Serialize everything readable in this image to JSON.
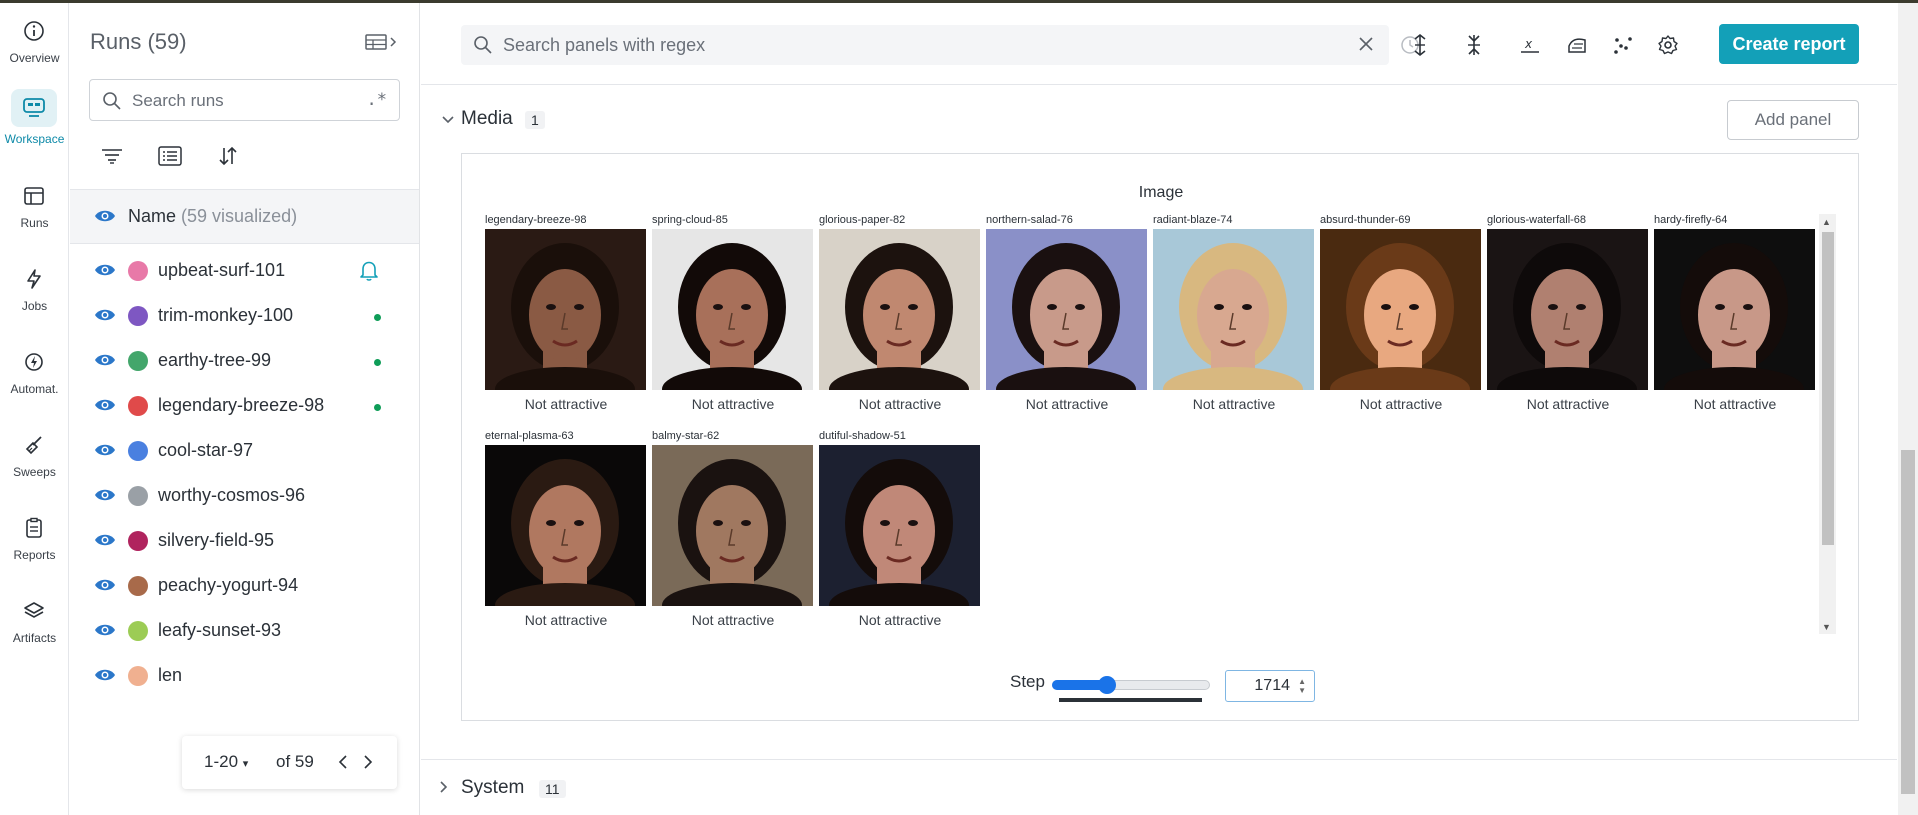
{
  "nav": {
    "items": [
      {
        "label": "Overview",
        "icon": "info-icon"
      },
      {
        "label": "Workspace",
        "icon": "workspace-icon",
        "active": true
      },
      {
        "label": "Runs",
        "icon": "table-icon"
      },
      {
        "label": "Jobs",
        "icon": "lightning-icon"
      },
      {
        "label": "Automat.",
        "icon": "automation-icon"
      },
      {
        "label": "Sweeps",
        "icon": "broom-icon"
      },
      {
        "label": "Reports",
        "icon": "clipboard-icon"
      },
      {
        "label": "Artifacts",
        "icon": "layers-icon"
      }
    ]
  },
  "runs": {
    "title": "Runs (59)",
    "search_placeholder": "Search runs",
    "regex_label": ".*",
    "header_name": "Name",
    "header_sub": "(59 visualized)",
    "rows": [
      {
        "name": "upbeat-surf-101",
        "color": "#e879a8",
        "status": "bell"
      },
      {
        "name": "trim-monkey-100",
        "color": "#7e57c2",
        "status": "live"
      },
      {
        "name": "earthy-tree-99",
        "color": "#43a66b",
        "status": "live"
      },
      {
        "name": "legendary-breeze-98",
        "color": "#e04a4a",
        "status": "live"
      },
      {
        "name": "cool-star-97",
        "color": "#4a80e0",
        "status": ""
      },
      {
        "name": "worthy-cosmos-96",
        "color": "#9aa0a6",
        "status": ""
      },
      {
        "name": "silvery-field-95",
        "color": "#b0245e",
        "status": ""
      },
      {
        "name": "peachy-yogurt-94",
        "color": "#a86a4a",
        "status": ""
      },
      {
        "name": "leafy-sunset-93",
        "color": "#9ccc55",
        "status": ""
      },
      {
        "name": "len",
        "color": "#f0b090",
        "status": ""
      }
    ],
    "pager": {
      "range": "1-20",
      "of": "of 59"
    }
  },
  "toolbar": {
    "search_placeholder": "Search panels with regex",
    "create_report": "Create report"
  },
  "media": {
    "title": "Media",
    "count": "1",
    "add_panel": "Add panel",
    "panel_title": "Image",
    "tiles": [
      {
        "run": "legendary-breeze-98",
        "caption": "Not attractive",
        "bg": "#2a1a14",
        "skin": "#8a5a44",
        "hair": "#1a0f0a"
      },
      {
        "run": "spring-cloud-85",
        "caption": "Not attractive",
        "bg": "#e6e6e6",
        "skin": "#a8705a",
        "hair": "#120a08"
      },
      {
        "run": "glorious-paper-82",
        "caption": "Not attractive",
        "bg": "#d8d2c8",
        "skin": "#c08870",
        "hair": "#1c120e"
      },
      {
        "run": "northern-salad-76",
        "caption": "Not attractive",
        "bg": "#8a90c8",
        "skin": "#c89a8a",
        "hair": "#1a1010"
      },
      {
        "run": "radiant-blaze-74",
        "caption": "Not attractive",
        "bg": "#a8c8d8",
        "skin": "#d8a890",
        "hair": "#d8b880"
      },
      {
        "run": "absurd-thunder-69",
        "caption": "Not attractive",
        "bg": "#4a2a10",
        "skin": "#e8a880",
        "hair": "#6a3a18"
      },
      {
        "run": "glorious-waterfall-68",
        "caption": "Not attractive",
        "bg": "#1a1414",
        "skin": "#b08070",
        "hair": "#0e0a0a"
      },
      {
        "run": "hardy-firefly-64",
        "caption": "Not attractive",
        "bg": "#0e0e0e",
        "skin": "#c89888",
        "hair": "#140c0a"
      },
      {
        "run": "eternal-plasma-63",
        "caption": "Not attractive",
        "bg": "#0a0808",
        "skin": "#b07860",
        "hair": "#2a1a12"
      },
      {
        "run": "balmy-star-62",
        "caption": "Not attractive",
        "bg": "#7a6a58",
        "skin": "#a07860",
        "hair": "#1a1210"
      },
      {
        "run": "dutiful-shadow-51",
        "caption": "Not attractive",
        "bg": "#1c2030",
        "skin": "#c08878",
        "hair": "#140c0a"
      }
    ],
    "step_label": "Step",
    "step_value": "1714",
    "step_fraction": 0.35
  },
  "system": {
    "title": "System",
    "count": "11"
  }
}
